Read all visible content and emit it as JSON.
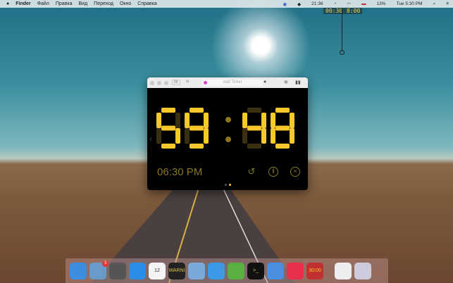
{
  "menubar": {
    "apple": "",
    "app": "Finder",
    "items": [
      "Файл",
      "Правка",
      "Вид",
      "Переход",
      "Окно",
      "Справка"
    ],
    "clock": "21:36",
    "battery": "13%",
    "datetime": "Tue 5:30 PM"
  },
  "mini_timers": [
    "00:30",
    "8:00"
  ],
  "window": {
    "add_timer_placeholder": "Add Timer",
    "digits": [
      "5",
      "9",
      "4",
      "8"
    ],
    "alarm_time": "06:30 PM",
    "accent": "#f7c82e",
    "dim": "#3a3010"
  },
  "dock": {
    "apps": [
      {
        "name": "finder",
        "color": "#3d8ee0"
      },
      {
        "name": "mail",
        "color": "#6a9bc8",
        "badge": "3"
      },
      {
        "name": "launchpad",
        "color": "#555"
      },
      {
        "name": "app-store",
        "color": "#2a8de8"
      },
      {
        "name": "calendar",
        "color": "#f4f4f4",
        "label": "12"
      },
      {
        "name": "console",
        "color": "#222",
        "label": "WARNI"
      },
      {
        "name": "preview",
        "color": "#7aa8d8"
      },
      {
        "name": "safari",
        "color": "#3a9ae8"
      },
      {
        "name": "leaf",
        "color": "#58b040"
      },
      {
        "name": "terminal",
        "color": "#111",
        "label": ">_"
      },
      {
        "name": "xcode",
        "color": "#4a8ee0"
      },
      {
        "name": "itunes",
        "color": "#e8304a"
      },
      {
        "name": "timer",
        "color": "#c03030",
        "label": "30:00"
      },
      {
        "name": "document",
        "color": "#eee"
      },
      {
        "name": "trash",
        "color": "#ccd"
      }
    ]
  }
}
